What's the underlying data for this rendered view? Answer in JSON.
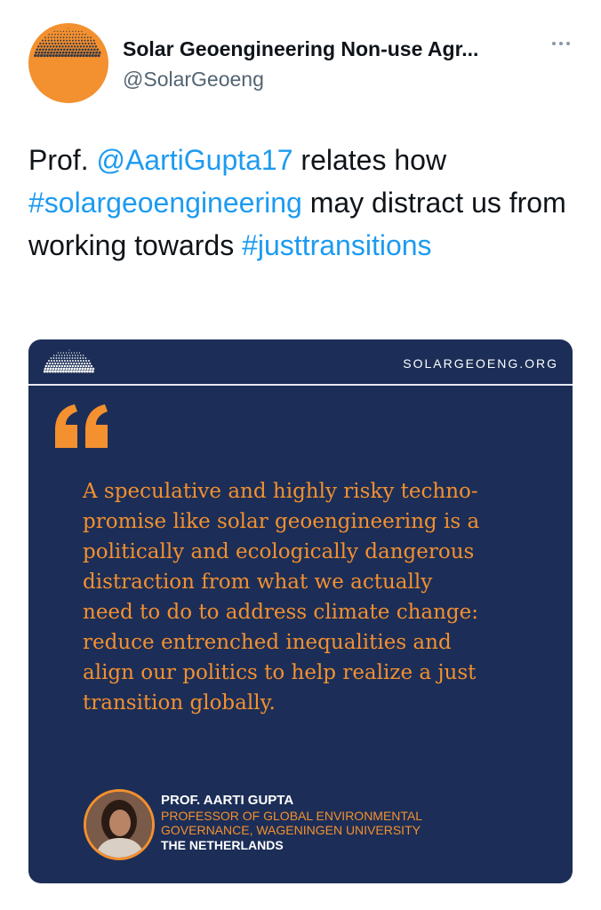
{
  "tweet": {
    "author": {
      "name": "Solar Geoengineering Non-use Agr...",
      "handle": "@SolarGeoeng"
    },
    "text_parts": {
      "prefix": "Prof. ",
      "mention": "@AartiGupta17",
      "middle_1": " relates how ",
      "hashtag_1": "#solargeoengineering",
      "middle_2": " may distract us from working towards ",
      "hashtag_2": "#justtransitions"
    },
    "more_icon": "more-horizontal-icon"
  },
  "card": {
    "site": "SOLARGEOENG.ORG",
    "quote_icon": "quote-mark-icon",
    "quote_lines": [
      "A speculative and highly risky techno-",
      "promise like solar geoengineering is a",
      "politically and ecologically dangerous",
      "distraction from what we actually",
      "need to do to address climate change:",
      "reduce entrenched inequalities and",
      "align our politics to help realize a just",
      "transition globally."
    ],
    "speaker": {
      "name": "PROF. AARTI GUPTA",
      "title_line_1": "PROFESSOR OF GLOBAL ENVIRONMENTAL",
      "title_line_2": "GOVERNANCE, WAGENINGEN UNIVERSITY",
      "country": "THE NETHERLANDS"
    }
  },
  "colors": {
    "accent_orange": "#f3902f",
    "card_navy": "#1c2e57",
    "link_blue": "#1d9bf0",
    "handle_gray": "#536471"
  }
}
